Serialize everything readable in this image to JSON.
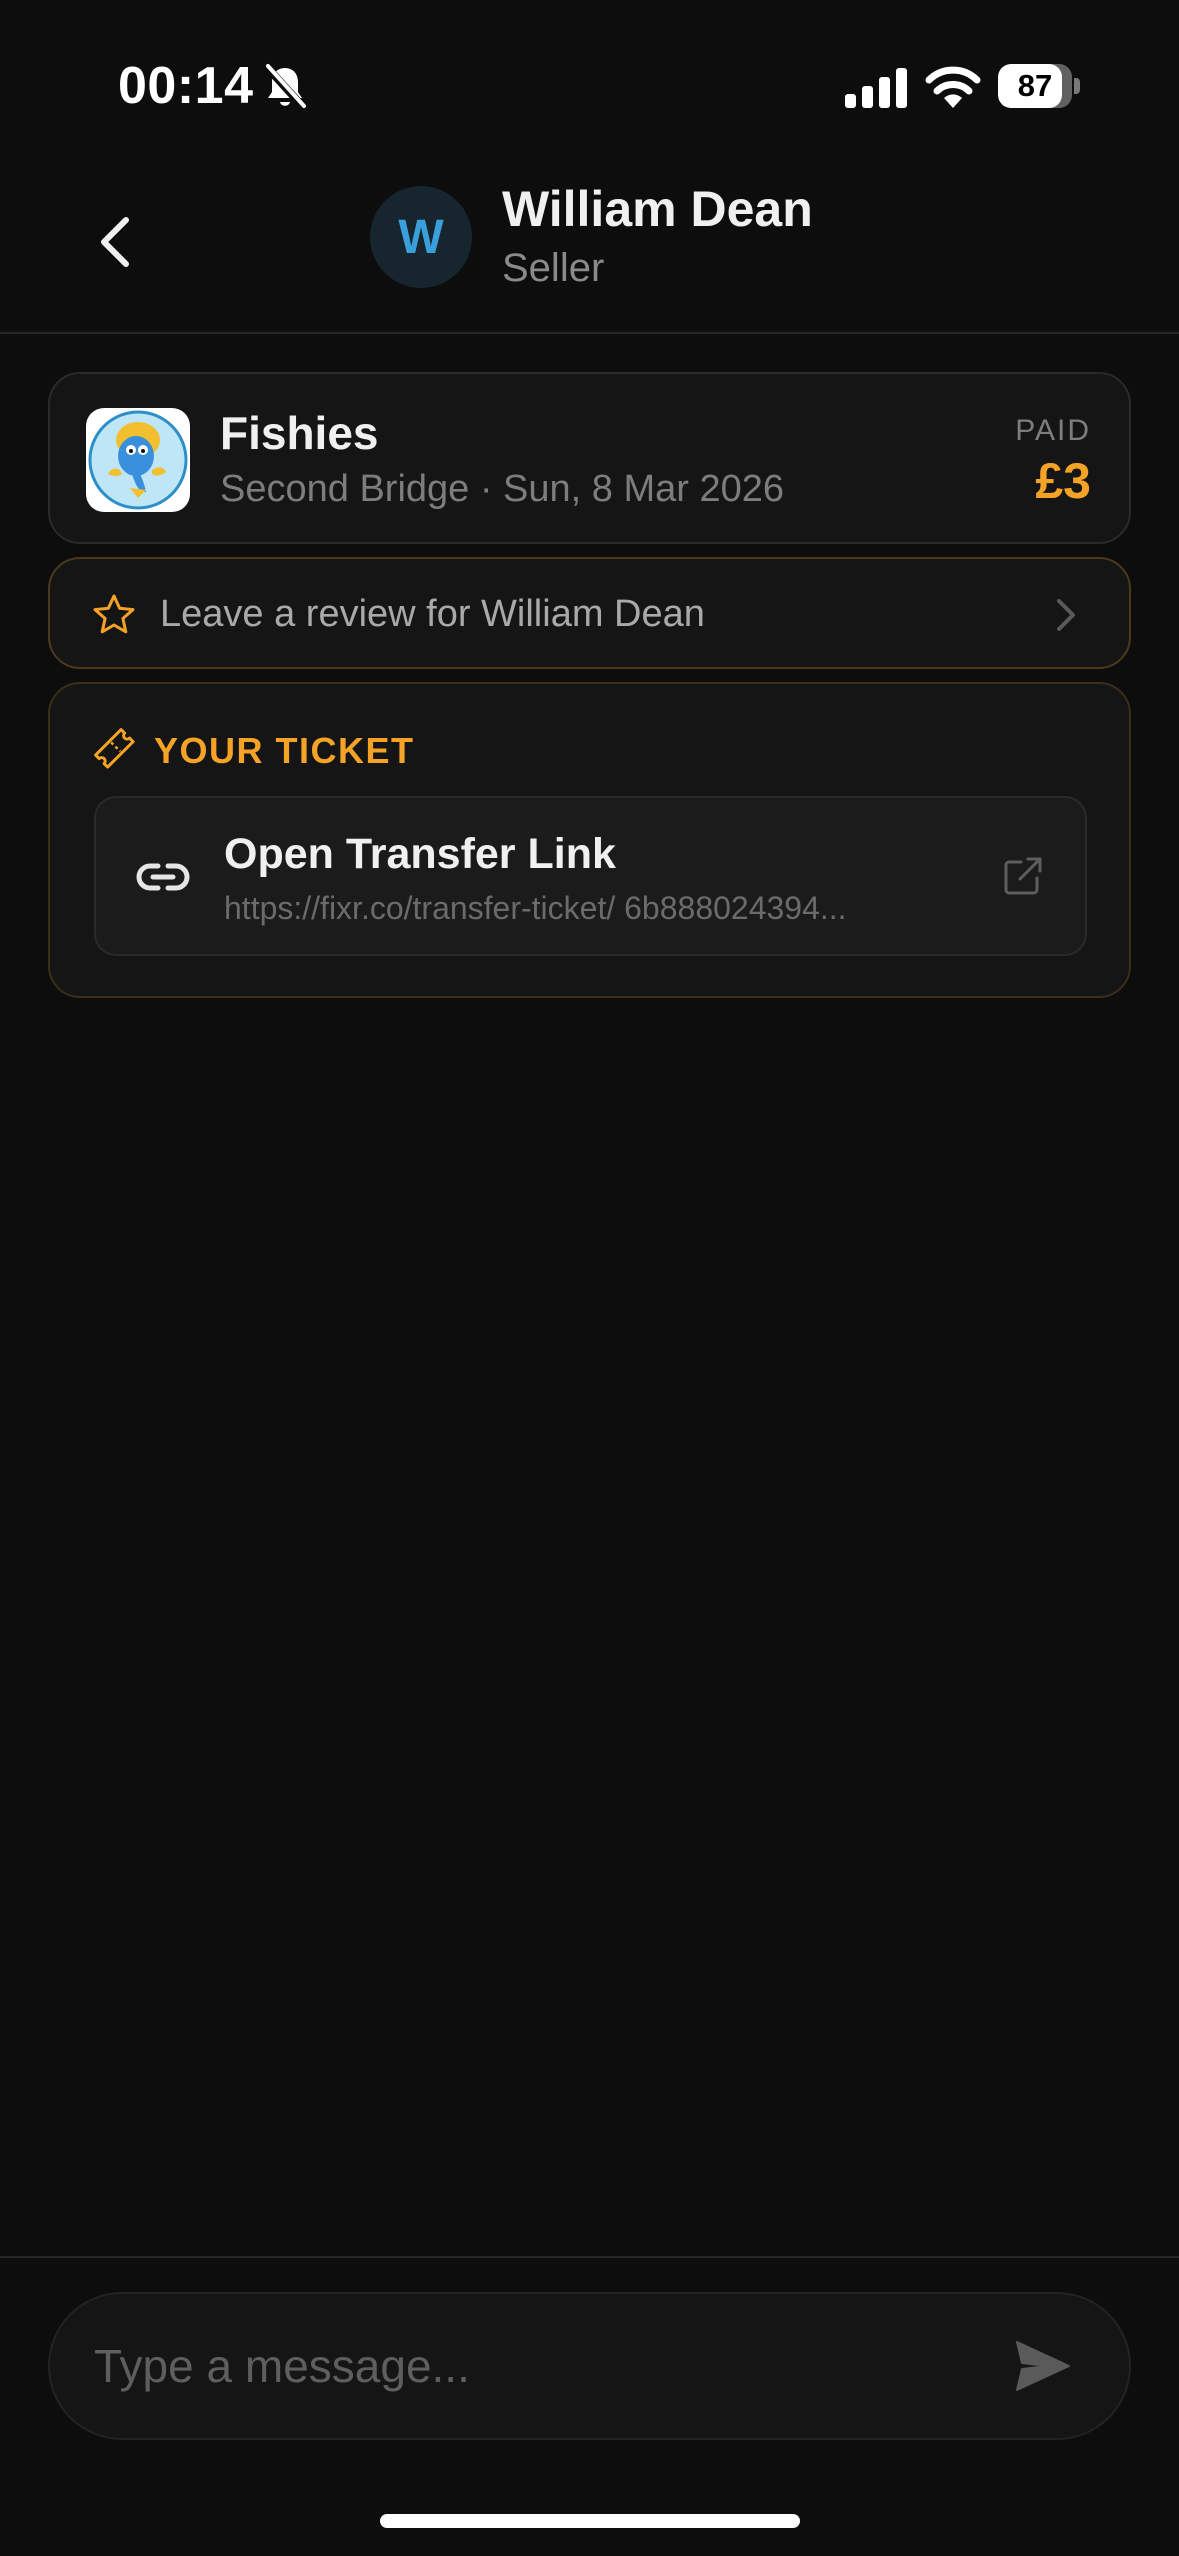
{
  "status_bar": {
    "time": "00:14",
    "battery_level": "87",
    "battery_fraction": 0.87
  },
  "header": {
    "avatar_initial": "W",
    "name": "William Dean",
    "role": "Seller"
  },
  "event": {
    "title": "Fishies",
    "subtitle": "Second Bridge · Sun, 8 Mar 2026",
    "paid_label": "PAID",
    "paid_amount": "£3"
  },
  "review": {
    "label": "Leave a review for William Dean"
  },
  "ticket": {
    "section_label": "YOUR TICKET",
    "transfer_title": "Open Transfer Link",
    "transfer_url": "https://fixr.co/transfer-ticket/ 6b888024394..."
  },
  "composer": {
    "placeholder": "Type a message..."
  },
  "colors": {
    "accent": "#f5a327",
    "avatar_text": "#3aa0dc",
    "background": "#0d0d0d",
    "card": "#151515"
  },
  "icons": [
    "mute-icon",
    "signal-icon",
    "wifi-icon",
    "back-chevron-icon",
    "star-icon",
    "chevron-right-icon",
    "ticket-icon",
    "link-icon",
    "external-link-icon",
    "send-icon"
  ]
}
